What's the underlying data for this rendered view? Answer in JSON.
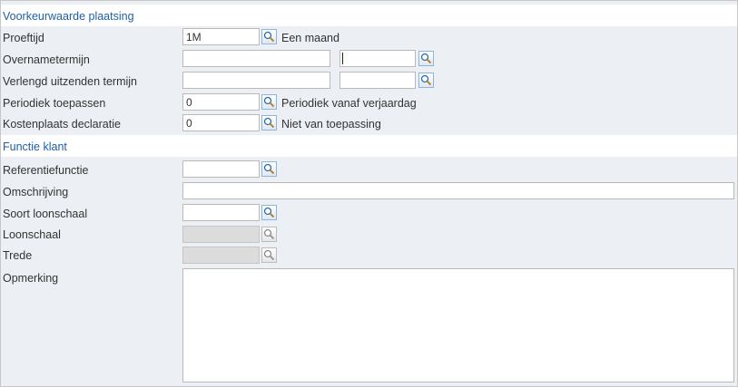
{
  "sections": {
    "placement": "Voorkeurwaarde plaatsing",
    "client_function": "Functie klant"
  },
  "fields": {
    "proeftijd": {
      "label": "Proeftijd",
      "value": "1M",
      "description": "Een maand"
    },
    "overnametermijn": {
      "label": "Overnametermijn",
      "value": "",
      "value2": ""
    },
    "verlengd": {
      "label": "Verlengd uitzenden termijn",
      "value": "",
      "value2": ""
    },
    "periodiek": {
      "label": "Periodiek toepassen",
      "value": "0",
      "description": "Periodiek vanaf verjaardag"
    },
    "kostenplaats": {
      "label": "Kostenplaats declaratie",
      "value": "0",
      "description": "Niet van toepassing"
    },
    "referentiefunctie": {
      "label": "Referentiefunctie",
      "value": ""
    },
    "omschrijving": {
      "label": "Omschrijving",
      "value": ""
    },
    "soort_loonschaal": {
      "label": "Soort loonschaal",
      "value": ""
    },
    "loonschaal": {
      "label": "Loonschaal",
      "value": ""
    },
    "trede": {
      "label": "Trede",
      "value": ""
    },
    "opmerking": {
      "label": "Opmerking",
      "value": ""
    }
  },
  "icons": {
    "lookup": "magnifier-lookup-icon"
  },
  "colors": {
    "section_text": "#1f5fa3",
    "panel_bg": "#eceff3",
    "disabled_bg": "#dcdcdc"
  }
}
